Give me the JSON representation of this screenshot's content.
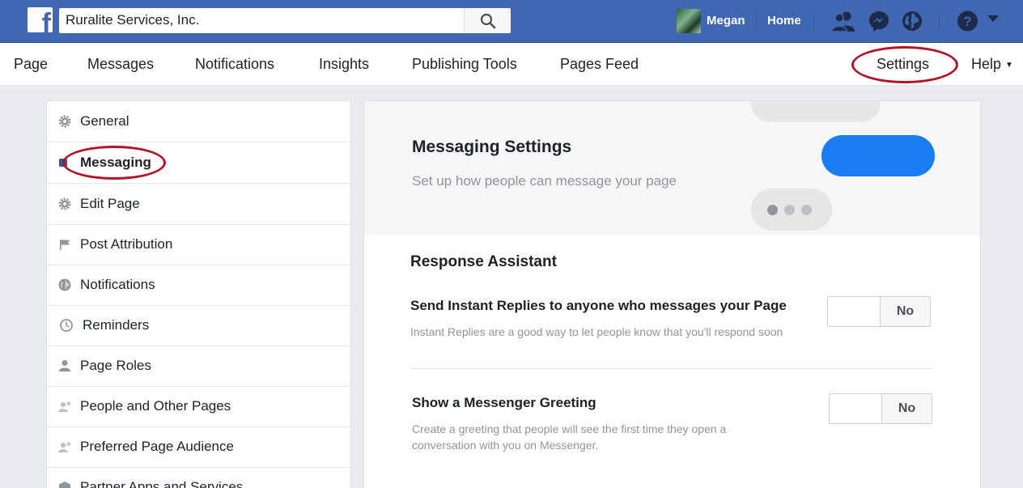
{
  "topbar": {
    "search_value": "Ruralite Services, Inc.",
    "user_name": "Megan",
    "home_label": "Home",
    "colors": {
      "brand": "#4267b2",
      "accent_ring": "#b3142a"
    }
  },
  "pagenav": {
    "items": [
      "Page",
      "Messages",
      "Notifications",
      "Insights",
      "Publishing Tools",
      "Pages Feed"
    ],
    "settings_label": "Settings",
    "help_label": "Help"
  },
  "sidebar": {
    "items": [
      {
        "label": "General",
        "icon": "gear-icon"
      },
      {
        "label": "Messaging",
        "icon": "messaging-icon",
        "active": true
      },
      {
        "label": "Edit Page",
        "icon": "gear-icon"
      },
      {
        "label": "Post Attribution",
        "icon": "flag-icon"
      },
      {
        "label": "Notifications",
        "icon": "globe-icon"
      },
      {
        "label": "Reminders",
        "icon": "clock-icon"
      },
      {
        "label": "Page Roles",
        "icon": "person-icon"
      },
      {
        "label": "People and Other Pages",
        "icon": "person-star-icon"
      },
      {
        "label": "Preferred Page Audience",
        "icon": "person-star-icon"
      },
      {
        "label": "Partner Apps and Services",
        "icon": "box-icon"
      }
    ]
  },
  "main": {
    "title": "Messaging Settings",
    "subtitle": "Set up how people can message your page",
    "section_title": "Response Assistant",
    "options": [
      {
        "title": "Send Instant Replies to anyone who messages your Page",
        "description": "Instant Replies are a good way to let people know that you'll respond soon",
        "toggle_label": "No"
      },
      {
        "title": "Show a Messenger Greeting",
        "description": "Create a greeting that people will see the first time they open a conversation with you on Messenger.",
        "toggle_label": "No"
      }
    ]
  }
}
